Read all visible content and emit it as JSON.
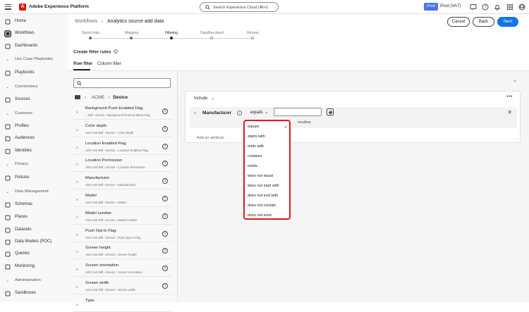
{
  "topbar": {
    "app_name": "Adobe Experience Platform",
    "logo_letter": "A",
    "search_placeholder": "Search Experience Cloud (⌘+/)",
    "env_badge": "Prod",
    "sandbox": "Prod (VA7)"
  },
  "sidebar": {
    "items": [
      {
        "type": "item",
        "label": "Home",
        "icon": "home-icon"
      },
      {
        "type": "item",
        "label": "Workflows",
        "icon": "workflows-icon",
        "active": true
      },
      {
        "type": "item",
        "label": "Dashboards",
        "icon": "dashboards-icon"
      },
      {
        "type": "section",
        "label": "Use Case Playbooks"
      },
      {
        "type": "item",
        "label": "Playbooks",
        "icon": "playbooks-icon"
      },
      {
        "type": "section",
        "label": "Connections"
      },
      {
        "type": "item",
        "label": "Sources",
        "icon": "sources-icon"
      },
      {
        "type": "section",
        "label": "Customer"
      },
      {
        "type": "item",
        "label": "Profiles",
        "icon": "profiles-icon"
      },
      {
        "type": "item",
        "label": "Audiences",
        "icon": "audiences-icon"
      },
      {
        "type": "item",
        "label": "Identities",
        "icon": "identities-icon"
      },
      {
        "type": "section",
        "label": "Privacy"
      },
      {
        "type": "item",
        "label": "Policies",
        "icon": "policies-icon"
      },
      {
        "type": "section",
        "label": "Data Management"
      },
      {
        "type": "item",
        "label": "Schemas",
        "icon": "schemas-icon"
      },
      {
        "type": "item",
        "label": "Places",
        "icon": "places-icon"
      },
      {
        "type": "item",
        "label": "Datasets",
        "icon": "datasets-icon"
      },
      {
        "type": "item",
        "label": "Data Models (POC)",
        "icon": "data-models-icon"
      },
      {
        "type": "item",
        "label": "Queries",
        "icon": "queries-icon"
      },
      {
        "type": "item",
        "label": "Monitoring",
        "icon": "monitoring-icon"
      },
      {
        "type": "section",
        "label": "Administration"
      },
      {
        "type": "item",
        "label": "Sandboxes",
        "icon": "sandboxes-icon"
      }
    ]
  },
  "breadcrumb": {
    "parent": "Workflows",
    "separator": "›",
    "current": "Analytics source add data"
  },
  "actions": {
    "cancel": "Cancel",
    "back": "Back",
    "next": "Next"
  },
  "steps": [
    {
      "label": "Select data",
      "state": "done"
    },
    {
      "label": "Mapping",
      "state": "done"
    },
    {
      "label": "Filtering",
      "state": "current"
    },
    {
      "label": "Dataflow detail",
      "state": "todo"
    },
    {
      "label": "Review",
      "state": "todo"
    }
  ],
  "section_title": "Create filter rules",
  "tabs": [
    "Row filter",
    "Column filter"
  ],
  "left_panel": {
    "path_root": "ACME",
    "path_sep": "›",
    "path_current": "Device",
    "attributes": [
      {
        "name": "Background Push Enabled Flag",
        "path": "...Will › Device › Background Push Enabled Flag"
      },
      {
        "name": "Color depth",
        "path": "ADC test Will › Device › Color depth"
      },
      {
        "name": "Location Enabled Flag",
        "path": "ADC test Will › Device › Location Enabled Flag"
      },
      {
        "name": "Location Permission",
        "path": "ADC test Will › Device › Location Permission"
      },
      {
        "name": "Manufacturer",
        "path": "ADC test Will › Device › Manufacturer"
      },
      {
        "name": "Model",
        "path": "ADC test Will › Device › Model"
      },
      {
        "name": "Model number",
        "path": "ADC test Will › Device › Model number"
      },
      {
        "name": "Push Opt In Flag",
        "path": "ADC test Will › Device › Push Opt In Flag"
      },
      {
        "name": "Screen height",
        "path": "ADC test Will › Device › Screen height"
      },
      {
        "name": "Screen orientation",
        "path": "ADC test Will › Device › Screen orientation"
      },
      {
        "name": "Screen width",
        "path": "ADC test Will › Device › Screen width"
      },
      {
        "name": "Type",
        "path": ""
      }
    ]
  },
  "rule_card": {
    "include": "Include",
    "field": "Manufacturer",
    "operator": "equals",
    "value": "",
    "case_sensitive_tail": "ensitive",
    "add_attribute": "Add an attribute",
    "more": "•••"
  },
  "operator_dropdown": {
    "selected": "equals",
    "options": [
      "equals",
      "starts with",
      "ends with",
      "contains",
      "exists",
      "does not equal",
      "does not start with",
      "does not end with",
      "does not contain",
      "does not exist"
    ]
  }
}
